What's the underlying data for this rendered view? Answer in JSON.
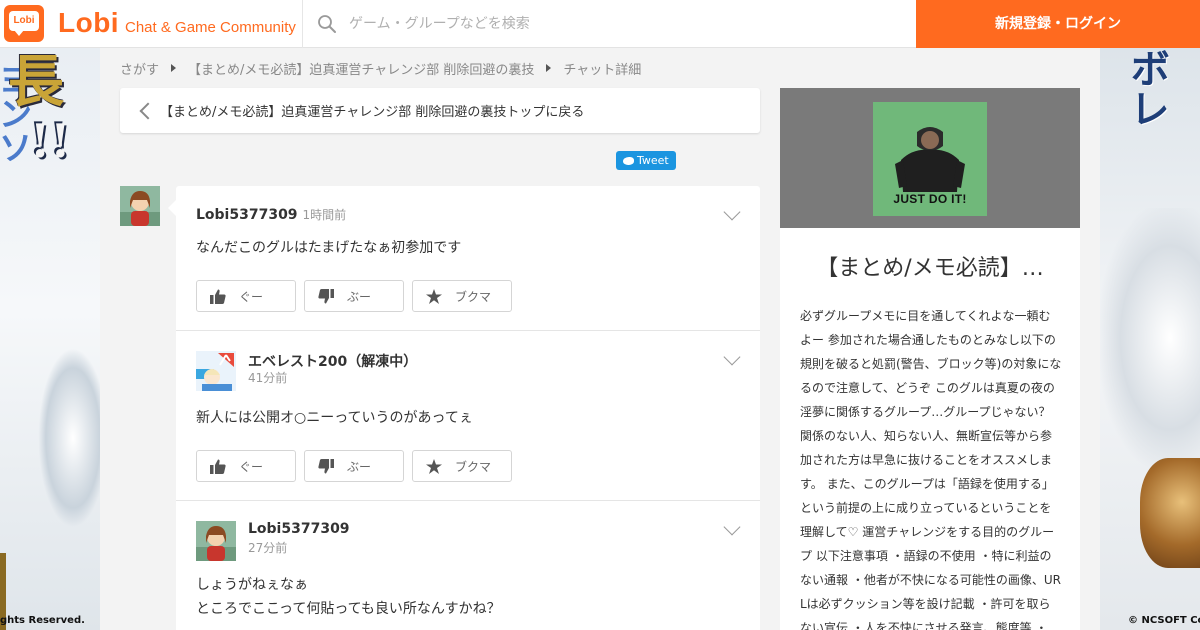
{
  "header": {
    "logo_text": "Lobi",
    "brand": "Lobi",
    "tagline": "Chat & Game Community",
    "search_placeholder": "ゲーム・グループなどを検索",
    "login_label": "新規登録・ログイン"
  },
  "ads": {
    "left": {
      "big": "長",
      "bang": "!!",
      "vertical": "ヨンソ",
      "copyright": "ghts Reserved."
    },
    "right": {
      "vertical": "ボレ",
      "copyright": "© NCSOFT Co"
    }
  },
  "breadcrumb": {
    "items": [
      "さがす",
      "【まとめ/メモ必読】迫真運営チャレンジ部 削除回避の裏技",
      "チャット詳細"
    ]
  },
  "back_card": {
    "label": "【まとめ/メモ必読】迫真運営チャレンジ部 削除回避の裏技トップに戻る"
  },
  "tweet": {
    "label": "Tweet"
  },
  "posts": [
    {
      "author": "Lobi5377309",
      "time": "1時間前",
      "body": "なんだこのグルはたまげたなぁ初参加です",
      "actions": {
        "good": "ぐー",
        "bad": "ぶー",
        "bookmark": "ブクマ"
      }
    },
    {
      "author": "エベレスト200（解凍中）",
      "time": "41分前",
      "body": "新人には公開オ○ニーっていうのがあってぇ",
      "actions": {
        "good": "ぐー",
        "bad": "ぶー",
        "bookmark": "ブクマ"
      }
    },
    {
      "author": "Lobi5377309",
      "time": "27分前",
      "body_lines": [
        "しょうがねぇなぁ",
        "ところでここって何貼っても良い所なんすかね？"
      ]
    }
  ],
  "group": {
    "cover_text": "JUST DO IT!",
    "title": "【まとめ/メモ必読】…",
    "description": "必ずグループメモに目を通してくれよな一頼むよー 参加された場合通したものとみなし以下の規則を破ると処罰(警告、ブロック等)の対象になるので注意して、どうぞ このグルは真夏の夜の淫夢に関係するグループ…グループじゃない？ 関係のない人、知らない人、無断宣伝等から参加された方は早急に抜けることをオススメします。 また、このグループは「語録を使用する」という前提の上に成り立っているということを理解して♡ 運営チャレンジをする目的のグループ 以下注意事項 ・語録の不使用 ・特に利益のない通報 ・他者が不快になる可能性の画像、URLは必ずクッション等を設け記載 ・許可を取らない宣伝 ・人を不快にさせる発言、態度等 ・"
  },
  "colors": {
    "brand_orange": "#ff6a1f",
    "tweet_blue": "#1b95e0",
    "cover_green": "#70b87a"
  }
}
